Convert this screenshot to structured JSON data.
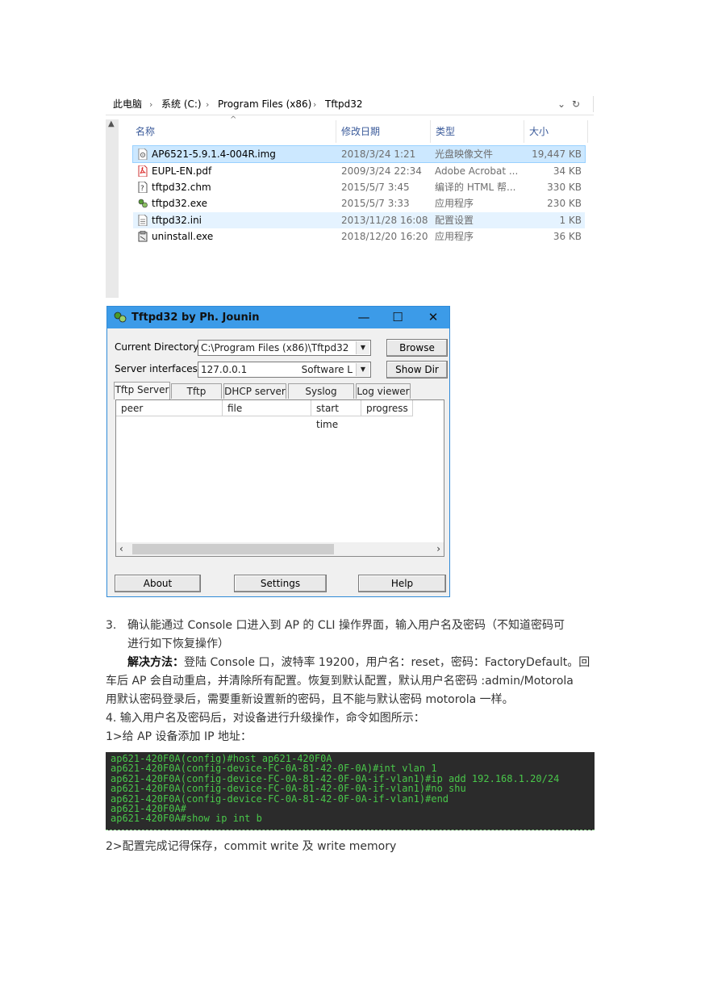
{
  "explorer": {
    "breadcrumb": [
      "此电脑",
      "系统 (C:)",
      "Program Files (x86)",
      "Tftpd32"
    ],
    "columns": {
      "name": "名称",
      "modified": "修改日期",
      "type": "类型",
      "size": "大小"
    },
    "files": [
      {
        "name": "AP6521-5.9.1.4-004R.img",
        "modified": "2018/3/24 1:21",
        "type": "光盘映像文件",
        "size": "19,447 KB",
        "icon": "disc-image-icon"
      },
      {
        "name": "EUPL-EN.pdf",
        "modified": "2009/3/24 22:34",
        "type": "Adobe Acrobat ...",
        "size": "34 KB",
        "icon": "pdf-icon"
      },
      {
        "name": "tftpd32.chm",
        "modified": "2015/5/7 3:45",
        "type": "编译的 HTML 帮...",
        "size": "330 KB",
        "icon": "help-file-icon"
      },
      {
        "name": "tftpd32.exe",
        "modified": "2015/5/7 3:33",
        "type": "应用程序",
        "size": "230 KB",
        "icon": "app-icon"
      },
      {
        "name": "tftpd32.ini",
        "modified": "2013/11/28 16:08",
        "type": "配置设置",
        "size": "1 KB",
        "icon": "settings-file-icon"
      },
      {
        "name": "uninstall.exe",
        "modified": "2018/12/20 16:20",
        "type": "应用程序",
        "size": "36 KB",
        "icon": "uninstall-icon"
      }
    ]
  },
  "tftpd": {
    "title": "Tftpd32 by Ph. Jounin",
    "current_directory_label": "Current Directory",
    "current_directory_value": "C:\\Program Files (x86)\\Tftpd32",
    "server_interfaces_label": "Server interfaces",
    "server_interfaces_value": "127.0.0.1",
    "server_interfaces_suffix": "Software L",
    "browse": "Browse",
    "show_dir": "Show Dir",
    "tabs": [
      "Tftp Server",
      "Tftp Client",
      "DHCP server",
      "Syslog server",
      "Log viewer"
    ],
    "list_columns": [
      "peer",
      "file",
      "start time",
      "progress"
    ],
    "about": "About",
    "settings": "Settings",
    "help": "Help"
  },
  "text": {
    "step3_num": "3.",
    "step3_line1": "确认能通过 Console 口进入到 AP 的 CLI 操作界面，输入用户名及密码（不知道密码可",
    "step3_line2": "进行如下恢复操作）",
    "solution_label": "解决方法：",
    "solution_line1": "登陆 Console 口，波特率 19200，用户名：reset，密码：FactoryDefault。回",
    "solution_line2": "车后 AP 会自动重启，并清除所有配置。恢复到默认配置，默认用户名密码 :admin/Motorola",
    "solution_line3": "用默认密码登录后，需要重新设置新的密码，且不能与默认密码 motorola 一样。",
    "step4": "4.   输入用户名及密码后，对设备进行升级操作，命令如图所示：",
    "sub1": "1>给 AP 设备添加 IP 地址：",
    "sub2": "2>配置完成记得保存，commit write 及 write memory"
  },
  "terminal": {
    "lines": [
      "ap621-420F0A(config)#host ap621-420F0A",
      "ap621-420F0A(config-device-FC-0A-81-42-0F-0A)#int vlan 1",
      "ap621-420F0A(config-device-FC-0A-81-42-0F-0A-if-vlan1)#ip add 192.168.1.20/24",
      "ap621-420F0A(config-device-FC-0A-81-42-0F-0A-if-vlan1)#no shu",
      "ap621-420F0A(config-device-FC-0A-81-42-0F-0A-if-vlan1)#end",
      "ap621-420F0A#",
      "ap621-420F0A#show ip int b"
    ]
  }
}
